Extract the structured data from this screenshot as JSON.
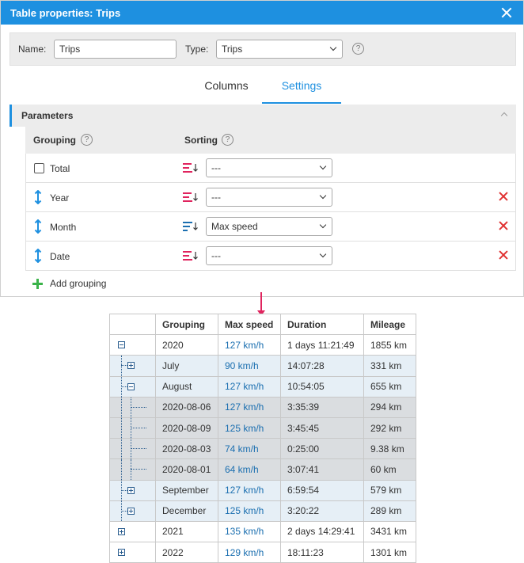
{
  "dialog": {
    "title": "Table properties: Trips",
    "name_label": "Name:",
    "name_value": "Trips",
    "type_label": "Type:",
    "type_value": "Trips",
    "tabs": [
      {
        "label": "Columns",
        "active": false
      },
      {
        "label": "Settings",
        "active": true
      }
    ],
    "section_title": "Parameters",
    "grouping_header": "Grouping",
    "sorting_header": "Sorting",
    "rows": [
      {
        "name": "Total",
        "sort": "---",
        "control": "checkbox",
        "deletable": false
      },
      {
        "name": "Year",
        "sort": "---",
        "control": "drag",
        "deletable": true
      },
      {
        "name": "Month",
        "sort": "Max speed",
        "control": "drag",
        "deletable": true
      },
      {
        "name": "Date",
        "sort": "---",
        "control": "drag",
        "deletable": true
      }
    ],
    "add_grouping": "Add grouping",
    "help_glyph": "?"
  },
  "report": {
    "headers": [
      "",
      "Grouping",
      "Max speed",
      "Duration",
      "Mileage"
    ],
    "rows": [
      {
        "level": 0,
        "toggle": "minus",
        "grouping": "2020",
        "speed": "127 km/h",
        "duration": "1 days 11:21:49",
        "mileage": "1855 km"
      },
      {
        "level": 1,
        "toggle": "plus",
        "grouping": "July",
        "speed": "90 km/h",
        "duration": "14:07:28",
        "mileage": "331 km"
      },
      {
        "level": 1,
        "toggle": "minus",
        "grouping": "August",
        "speed": "127 km/h",
        "duration": "10:54:05",
        "mileage": "655 km"
      },
      {
        "level": 2,
        "toggle": "none",
        "grouping": "2020-08-06",
        "speed": "127 km/h",
        "duration": "3:35:39",
        "mileage": "294 km"
      },
      {
        "level": 2,
        "toggle": "none",
        "grouping": "2020-08-09",
        "speed": "125 km/h",
        "duration": "3:45:45",
        "mileage": "292 km"
      },
      {
        "level": 2,
        "toggle": "none",
        "grouping": "2020-08-03",
        "speed": "74 km/h",
        "duration": "0:25:00",
        "mileage": "9.38 km"
      },
      {
        "level": 2,
        "toggle": "none",
        "grouping": "2020-08-01",
        "speed": "64 km/h",
        "duration": "3:07:41",
        "mileage": "60 km"
      },
      {
        "level": 1,
        "toggle": "plus",
        "grouping": "September",
        "speed": "127 km/h",
        "duration": "6:59:54",
        "mileage": "579 km"
      },
      {
        "level": 1,
        "toggle": "plus",
        "grouping": "December",
        "speed": "125 km/h",
        "duration": "3:20:22",
        "mileage": "289 km"
      },
      {
        "level": 0,
        "toggle": "plus",
        "grouping": "2021",
        "speed": "135 km/h",
        "duration": "2 days 14:29:41",
        "mileage": "3431 km"
      },
      {
        "level": 0,
        "toggle": "plus",
        "grouping": "2022",
        "speed": "129 km/h",
        "duration": "18:11:23",
        "mileage": "1301 km"
      }
    ]
  },
  "colors": {
    "accent": "#1e90e0",
    "delete": "#e03030",
    "add": "#3bb34a",
    "arrow": "#e0245e",
    "speed_link": "#1b6fb0"
  }
}
